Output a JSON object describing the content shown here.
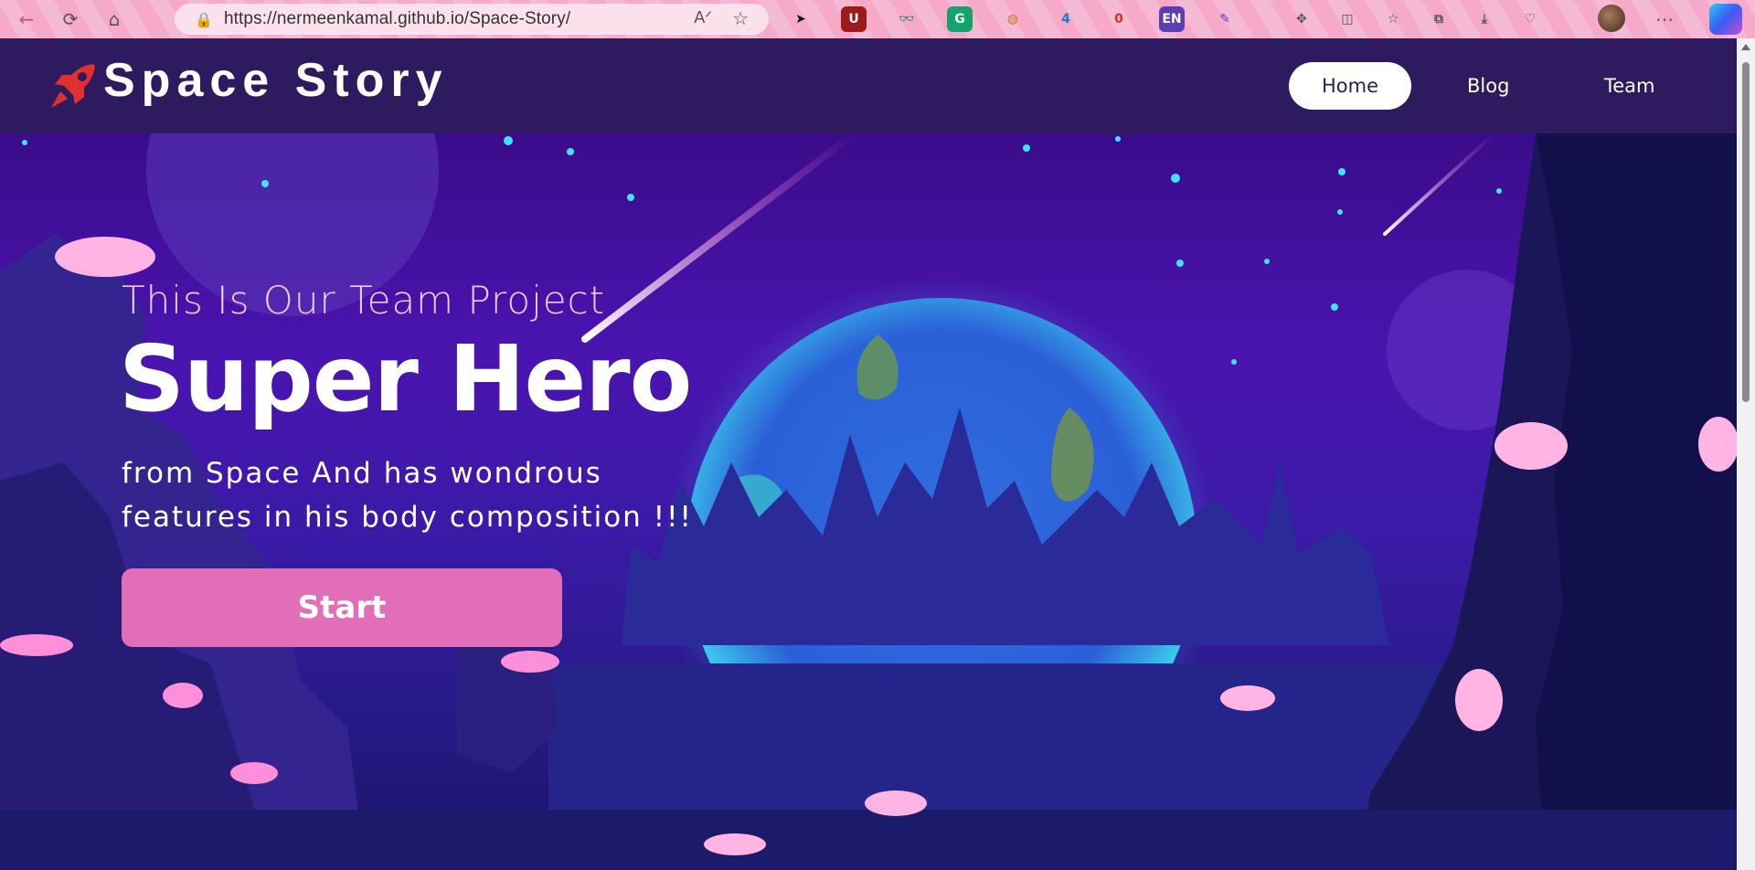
{
  "browser": {
    "url": "https://nermeenkamal.github.io/Space-Story/",
    "icons": [
      "back-icon",
      "refresh-icon",
      "home-icon"
    ],
    "extensions": [
      {
        "name": "cursor-extension-icon",
        "glyph": "➤",
        "bg": "transparent",
        "fg": "#111"
      },
      {
        "name": "ublock-extension-icon",
        "glyph": "U",
        "bg": "#9b1b1b",
        "fg": "#fff"
      },
      {
        "name": "glasses-extension-icon",
        "glyph": "👓",
        "bg": "transparent",
        "fg": "#333"
      },
      {
        "name": "grammarly-extension-icon",
        "glyph": "G",
        "bg": "#14a36b",
        "fg": "#fff"
      },
      {
        "name": "egg-extension-icon",
        "glyph": "◍",
        "bg": "transparent",
        "fg": "#c97a1f"
      },
      {
        "name": "puzzle-badge-extension-icon",
        "glyph": "4",
        "bg": "transparent",
        "fg": "#1976d2"
      },
      {
        "name": "lock-badge-extension-icon",
        "glyph": "0",
        "bg": "transparent",
        "fg": "#d32f2f"
      },
      {
        "name": "language-extension-icon",
        "glyph": "EN",
        "bg": "#5b3db5",
        "fg": "#fff"
      },
      {
        "name": "eyedropper-extension-icon",
        "glyph": "✎",
        "bg": "transparent",
        "fg": "#5a3cc8"
      }
    ],
    "toolbar_right": [
      "extensions-icon",
      "split-screen-icon",
      "favorites-icon",
      "collections-icon",
      "downloads-icon",
      "health-icon"
    ]
  },
  "site": {
    "brand": "Space Story",
    "nav": {
      "home": "Home",
      "blog": "Blog",
      "team": "Team"
    }
  },
  "hero": {
    "kicker": "This Is Our Team Project",
    "title": "Super Hero",
    "description": "from Space And has wondrous features in his body composition !!!",
    "start_label": "Start"
  },
  "colors": {
    "header_bg": "#2d1a5f",
    "accent_pink": "#e26db8",
    "logo_red": "#e0312e"
  }
}
